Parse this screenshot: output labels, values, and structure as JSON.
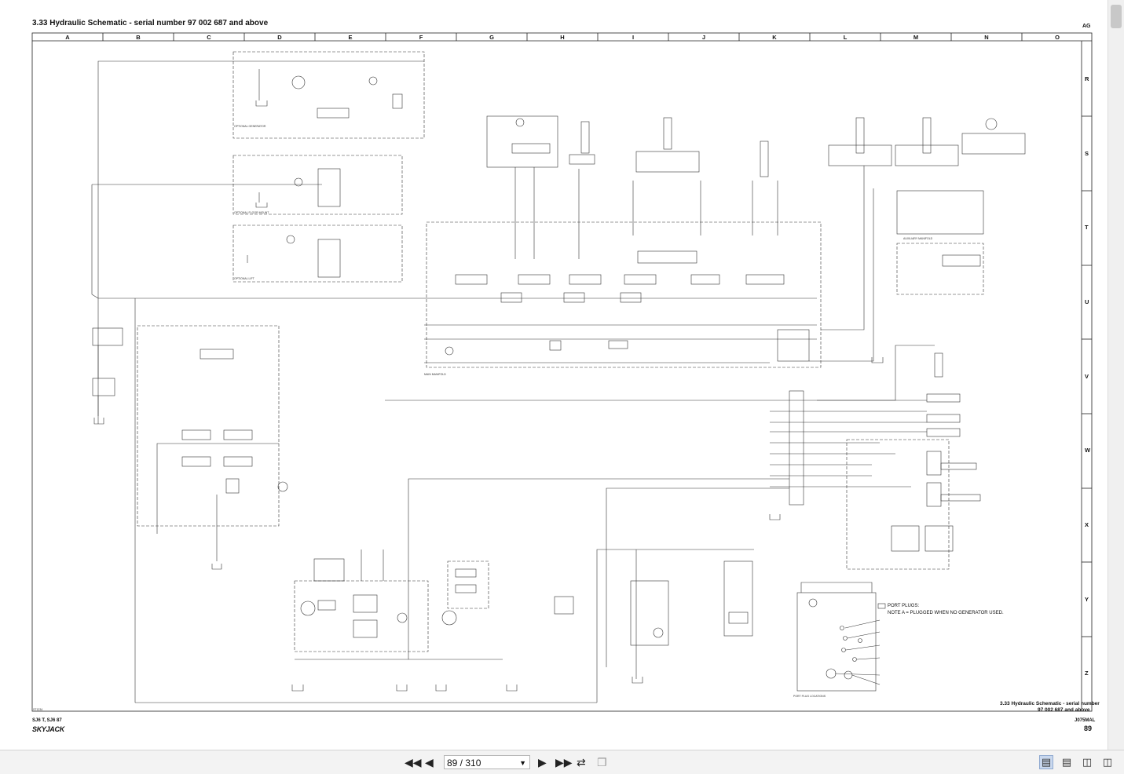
{
  "document": {
    "title": "3.33  Hydraulic Schematic - serial number 97 002 687 and above",
    "page_code": "AG",
    "columns": [
      "A",
      "B",
      "C",
      "D",
      "E",
      "F",
      "G",
      "H",
      "I",
      "J",
      "K",
      "L",
      "M",
      "N",
      "O"
    ],
    "rows": [
      "R",
      "S",
      "T",
      "U",
      "V",
      "W",
      "X",
      "Y",
      "Z"
    ],
    "port_plugs_title": "PORT PLUGS:",
    "port_plugs_note": "NOTE A = PLUGGED WHEN NO GENERATOR USED.",
    "caption_line1": "3.33  Hydraulic Schematic - serial number",
    "caption_line2": "97 002 687 and above",
    "model": "SJ6 T, SJ6 87",
    "brand": "SKYJACK",
    "manual": "J075MAL",
    "page_number": "89"
  },
  "viewer": {
    "page_indicator": "89 / 310",
    "dropdown_icon": "chevron-down-icon",
    "nav_icons": [
      "first-page-icon",
      "previous-page-icon",
      "next-page-icon",
      "last-page-icon",
      "rotate-icon",
      "duplicate-icon"
    ],
    "view_icons": [
      "single-page-icon",
      "continuous-icon",
      "two-page-icon",
      "two-page-continuous-icon"
    ]
  }
}
